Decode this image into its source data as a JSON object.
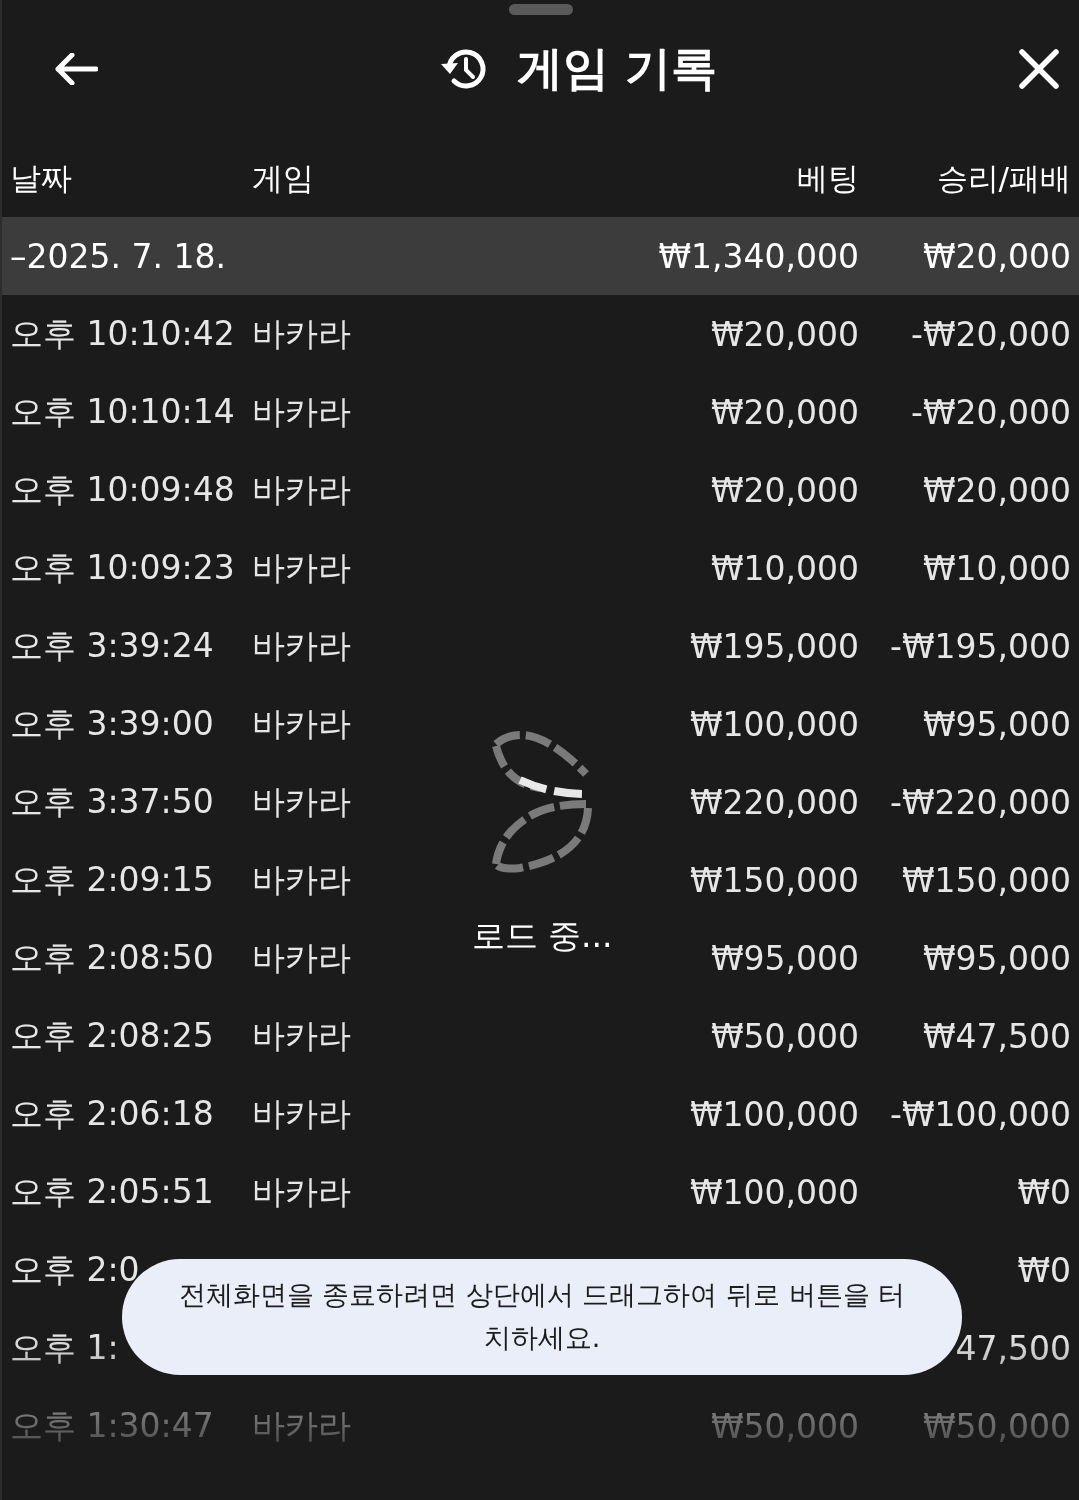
{
  "header": {
    "title": "게임 기록"
  },
  "table": {
    "columns": [
      "날짜",
      "게임",
      "베팅",
      "승리/패배"
    ],
    "summary": {
      "date": "–2025. 7. 18.",
      "bet": "₩1,340,000",
      "result": "₩20,000"
    },
    "rows": [
      {
        "time": "오후 10:10:42",
        "game": "바카라",
        "bet": "₩20,000",
        "result": "-₩20,000"
      },
      {
        "time": "오후 10:10:14",
        "game": "바카라",
        "bet": "₩20,000",
        "result": "-₩20,000"
      },
      {
        "time": "오후 10:09:48",
        "game": "바카라",
        "bet": "₩20,000",
        "result": "₩20,000"
      },
      {
        "time": "오후 10:09:23",
        "game": "바카라",
        "bet": "₩10,000",
        "result": "₩10,000"
      },
      {
        "time": "오후 3:39:24",
        "game": "바카라",
        "bet": "₩195,000",
        "result": "-₩195,000"
      },
      {
        "time": "오후 3:39:00",
        "game": "바카라",
        "bet": "₩100,000",
        "result": "₩95,000"
      },
      {
        "time": "오후 3:37:50",
        "game": "바카라",
        "bet": "₩220,000",
        "result": "-₩220,000"
      },
      {
        "time": "오후 2:09:15",
        "game": "바카라",
        "bet": "₩150,000",
        "result": "₩150,000"
      },
      {
        "time": "오후 2:08:50",
        "game": "바카라",
        "bet": "₩95,000",
        "result": "₩95,000"
      },
      {
        "time": "오후 2:08:25",
        "game": "바카라",
        "bet": "₩50,000",
        "result": "₩47,500"
      },
      {
        "time": "오후 2:06:18",
        "game": "바카라",
        "bet": "₩100,000",
        "result": "-₩100,000"
      },
      {
        "time": "오후 2:05:51",
        "game": "바카라",
        "bet": "₩100,000",
        "result": "₩0"
      },
      {
        "time": "오후 2:0",
        "result": "₩0"
      },
      {
        "time": "오후 1:",
        "result": "47,500"
      },
      {
        "time": "오후 1:30:47",
        "game": "바카라",
        "bet": "₩50,000",
        "result": "₩50,000"
      }
    ]
  },
  "loading": {
    "label": "로드 중..."
  },
  "toast": {
    "text": "전체화면을 종료하려면 상단에서 드래그하여 뒤로 버튼을 터치하세요."
  }
}
